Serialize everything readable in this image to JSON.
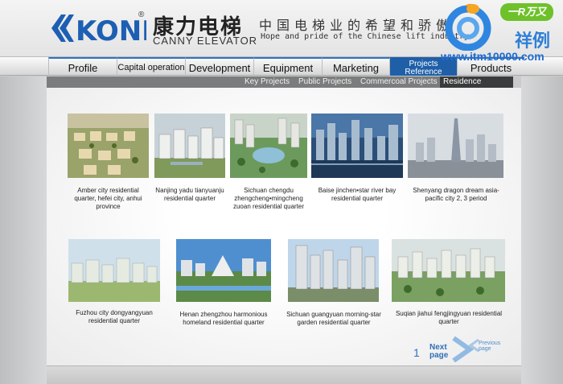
{
  "header": {
    "logo_text": "KONL",
    "brand_cn": "康力电梯",
    "brand_en": "CANNY ELEVATOR",
    "slogan_cn": "中国电梯业的希望和骄傲",
    "slogan_en": "Hope and pride of the Chinese lift industry"
  },
  "watermark": {
    "badge": "一R万又",
    "word": "祥例",
    "url": "www.itm10000.com"
  },
  "nav": {
    "items": [
      {
        "label": "Profile"
      },
      {
        "label": "Capital operation"
      },
      {
        "label": "Development"
      },
      {
        "label": "Equipment"
      },
      {
        "label": "Marketing"
      },
      {
        "label_line1": "Projects",
        "label_line2": "Reference",
        "active": true
      },
      {
        "label": "Products"
      }
    ]
  },
  "subnav": {
    "items": [
      {
        "label": "Key Projects"
      },
      {
        "label": "Public Projects"
      },
      {
        "label": "Commercoal Projects"
      },
      {
        "label": "Residence Projects",
        "active": true
      }
    ]
  },
  "projects": [
    {
      "caption": "Amber city residential quarter, hefei city, anhui province"
    },
    {
      "caption": "Nanjing yadu tianyuanju residential quarter"
    },
    {
      "caption": "Sichuan chengdu zhengcheng•mingcheng zuoan residential quarter"
    },
    {
      "caption": "Baise jinchen•star river bay residential quarter"
    },
    {
      "caption": "Shenyang dragon dream asia-pacific city 2, 3 period"
    },
    {
      "caption": "Fuzhou city dongyangyuan residential quarter"
    },
    {
      "caption": "Henan zhengzhou harmonious homeland residential quarter"
    },
    {
      "caption": "Sichuan guangyuan morning-star garden residential quarter"
    },
    {
      "caption": "Suqian jiahui fengjingyuan residential quarter"
    }
  ],
  "pagination": {
    "page": "1",
    "next_line1": "Next",
    "next_line2": "page",
    "prev_line1": "Previous",
    "prev_line2": "page"
  },
  "colors": {
    "accent": "#1f5fa8",
    "link": "#2f6fb8"
  }
}
